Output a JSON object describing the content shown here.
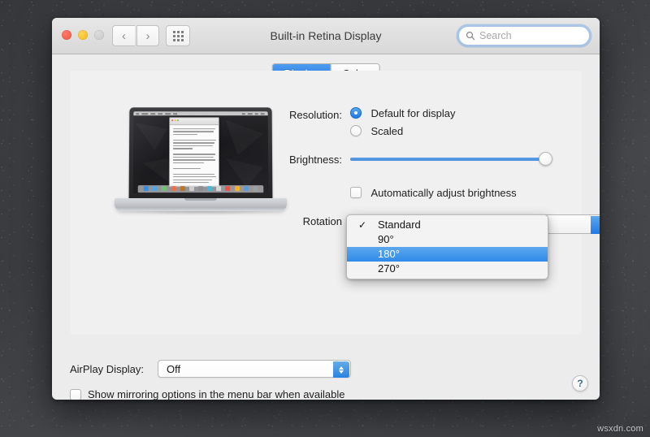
{
  "window": {
    "title": "Built-in Retina Display",
    "traffic_lights": [
      "close",
      "minimize",
      "zoom"
    ],
    "nav": {
      "back": "‹",
      "forward": "›"
    },
    "show_all_icon": "grid-icon"
  },
  "search": {
    "placeholder": "Search",
    "value": "",
    "icon": "search-icon"
  },
  "tabs": [
    {
      "label": "Display",
      "active": true
    },
    {
      "label": "Color",
      "active": false
    }
  ],
  "preview": {
    "device": "macbook-pro-illustration"
  },
  "resolution": {
    "label": "Resolution:",
    "options": [
      {
        "label": "Default for display",
        "selected": true
      },
      {
        "label": "Scaled",
        "selected": false
      }
    ]
  },
  "brightness": {
    "label": "Brightness:",
    "value_percent": 98,
    "auto_adjust": {
      "label": "Automatically adjust brightness",
      "checked": false
    }
  },
  "rotation": {
    "label": "Rotation",
    "current": "Standard",
    "menu_open": true,
    "options": [
      {
        "label": "Standard",
        "checked": true,
        "highlighted": false
      },
      {
        "label": "90°",
        "checked": false,
        "highlighted": false
      },
      {
        "label": "180°",
        "checked": false,
        "highlighted": true
      },
      {
        "label": "270°",
        "checked": false,
        "highlighted": false
      }
    ]
  },
  "airplay": {
    "label": "AirPlay Display:",
    "value": "Off"
  },
  "mirroring": {
    "label": "Show mirroring options in the menu bar when available",
    "checked": false
  },
  "help": {
    "label": "?"
  },
  "watermark": {
    "text": "wsxdn.com"
  },
  "colors": {
    "accent_blue": "#2079e4",
    "selection_blue": "#2f8be8",
    "window_bg": "#ececec",
    "panel_bg": "#f0f0f0"
  }
}
